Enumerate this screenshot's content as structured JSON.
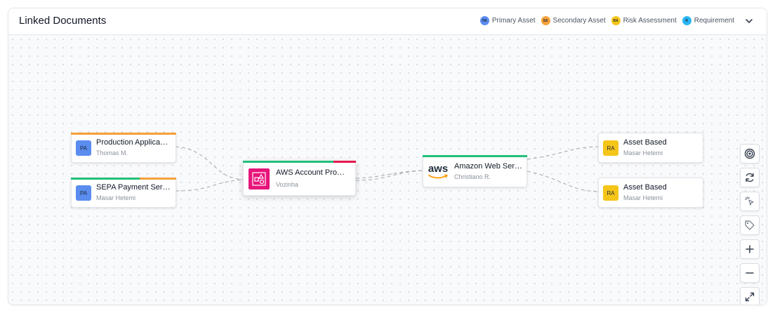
{
  "header": {
    "title": "Linked Documents"
  },
  "legend": [
    {
      "code": "PA",
      "label": "Primary Asset",
      "color": "#5b8def"
    },
    {
      "code": "SA",
      "label": "Secondary Asset",
      "color": "#f5a13a"
    },
    {
      "code": "RA",
      "label": "Risk Assessment",
      "color": "#f5c518"
    },
    {
      "code": "R",
      "label": "Requirement",
      "color": "#29b6f6"
    }
  ],
  "nodes": {
    "prod_app": {
      "code": "PA",
      "title": "Production Applica…",
      "subtitle": "Thomas M."
    },
    "sepa": {
      "code": "PA",
      "title": "SEPA Payment Serv…",
      "subtitle": "Masar Hetemi"
    },
    "aws_account": {
      "title": "AWS Account Pro…",
      "subtitle": "Vozinha",
      "icon": "aws-organizations-icon"
    },
    "amazon_web": {
      "title": "Amazon Web Ser…",
      "subtitle": "Christiano R.",
      "icon": "aws-logo",
      "logo_text": "aws"
    },
    "asset_based_1": {
      "code": "RA",
      "title": "Asset Based",
      "subtitle": "Masar Hetemi"
    },
    "asset_based_2": {
      "code": "RA",
      "title": "Asset Based",
      "subtitle": "Masar Hetemi"
    }
  },
  "colors": {
    "primary": "#5b8def",
    "secondary": "#f5a13a",
    "risk": "#f5c518",
    "green": "#22c07a",
    "red": "#e8194b",
    "aws_pink": "#e7157b"
  },
  "controls": [
    "focus-icon",
    "refresh-icon",
    "pointer-click-icon",
    "tag-icon",
    "zoom-in-icon",
    "zoom-out-icon",
    "fit-screen-icon"
  ]
}
